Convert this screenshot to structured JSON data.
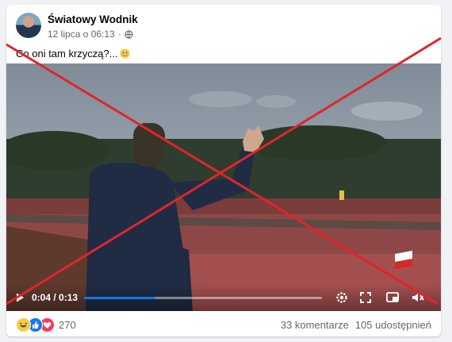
{
  "post": {
    "author": "Światowy Wodnik",
    "timestamp": "12 lipca o 06:13",
    "separator": "·",
    "privacy_icon": "globe-icon",
    "text": "Co oni tam krzyczą?...",
    "text_emoji": "grinning-face-emoji"
  },
  "video": {
    "current_time": "0:04",
    "duration": "0:13",
    "time_separator": " / ",
    "progress_fraction": 0.3,
    "controls": [
      "play-icon",
      "settings-icon",
      "fullscreen-icon",
      "pip-icon",
      "volume-icon"
    ]
  },
  "footer": {
    "reactions": [
      "haha-icon",
      "like-icon",
      "love-icon"
    ],
    "reaction_count": "270",
    "comments": "33 komentarze",
    "shares": "105 udostępnień"
  },
  "colors": {
    "overlay_cross": "#e0252b",
    "progress": "#1b74e4",
    "meta_text": "#65676b"
  }
}
